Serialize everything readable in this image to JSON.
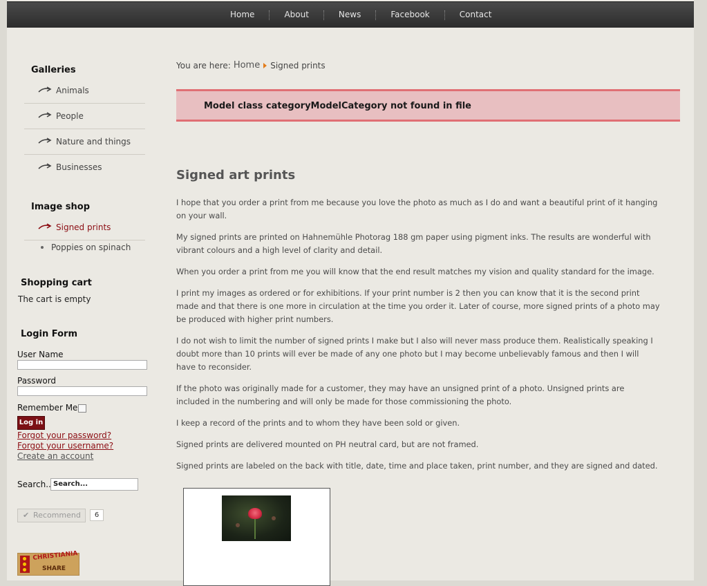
{
  "nav": {
    "items": [
      "Home",
      "About",
      "News",
      "Facebook",
      "Contact"
    ]
  },
  "sidebar": {
    "galleries": {
      "title": "Galleries",
      "items": [
        "Animals",
        "People",
        "Nature and things",
        "Businesses"
      ]
    },
    "image_shop": {
      "title": "Image shop",
      "active_item": "Signed prints",
      "sub_items": [
        "Poppies on spinach"
      ]
    },
    "cart": {
      "title": "Shopping cart",
      "status": "The cart is empty"
    },
    "login": {
      "title": "Login Form",
      "username_label": "User Name",
      "password_label": "Password",
      "remember_label": "Remember Me",
      "login_button": "Log in",
      "forgot_password": "Forgot your password?",
      "forgot_username": "Forgot your username?",
      "create_account": "Create an account"
    },
    "search": {
      "label": "Search...",
      "placeholder": "Search..."
    },
    "recommend": {
      "label": "Recommend",
      "count": "6"
    },
    "share_logo": {
      "text1": "CHRISTIANIA",
      "text2": "SHARE"
    }
  },
  "main": {
    "breadcrumb": {
      "prefix": "You are here:",
      "home": "Home",
      "current": "Signed prints"
    },
    "error_message": "Model class categoryModelCategory not found in file",
    "title": "Signed art prints",
    "paragraphs": [
      "I hope that you order a print from me because you love the photo as much as I do and want a beautiful print of it hanging on your wall.",
      "My signed prints are printed on Hahnemühle Photorag 188 gm paper using pigment inks. The results are wonderful with vibrant colours and a high level of clarity and detail.",
      "When you order a print from me you will know that the end result matches my vision and quality standard for the image.",
      "I print my images as ordered or for exhibitions. If your print number is 2 then you can know that it is the second print made and that there is one more in circulation at the time you order it. Later of course, more signed prints of a photo may be produced with higher print numbers.",
      "I do not wish to limit the number of signed prints I make but I also will never mass produce them. Realistically speaking I doubt more than 10 prints will ever be made of any one photo but I may become unbelievably famous and then I will have to reconsider.",
      "If the photo was originally made for a customer, they may have an unsigned print of a  photo. Unsigned prints are included in the numbering and will only be made for those commissioning the photo.",
      "I keep a record of the prints and to whom they have been sold or given.",
      "Signed prints are delivered mounted on PH neutral card, but are not framed.",
      "Signed prints are labeled on the back with title, date, time and place taken, print number, and they are signed and dated."
    ]
  },
  "colors": {
    "nav_bg": "#3a3a3a",
    "accent_red": "#8c0e14",
    "error_bg": "#e8bfc1",
    "error_border": "#e06f74",
    "breadcrumb_arrow": "#e27c1a"
  }
}
